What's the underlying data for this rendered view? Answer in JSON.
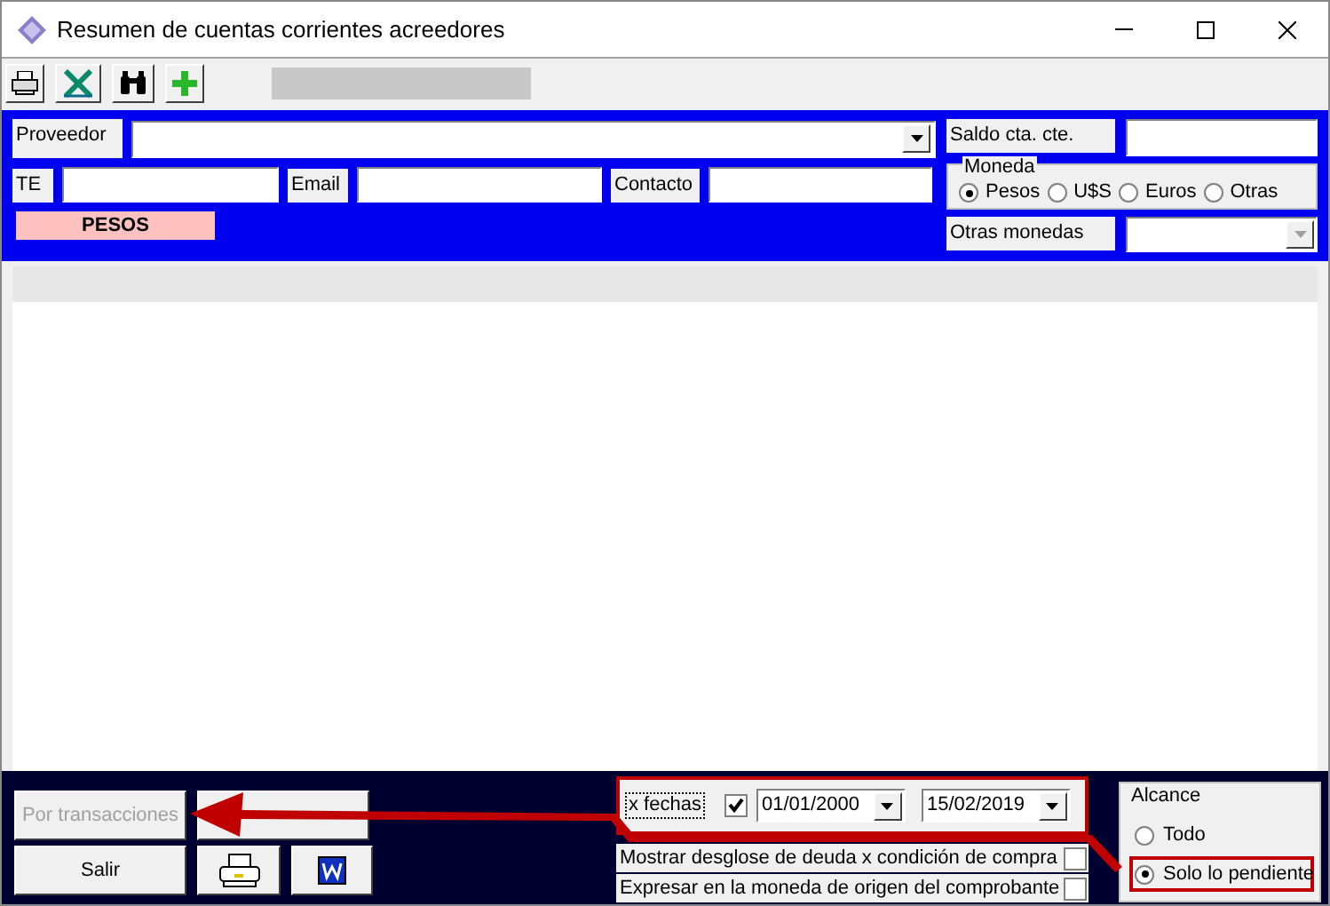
{
  "window": {
    "title": "Resumen de cuentas corrientes acreedores"
  },
  "form": {
    "proveedor_label": "Proveedor",
    "te_label": "TE",
    "email_label": "Email",
    "contacto_label": "Contacto",
    "currency_badge": "PESOS",
    "saldo_label": "Saldo cta. cte.",
    "otras_monedas_label": "Otras monedas",
    "moneda": {
      "title": "Moneda",
      "options": [
        {
          "label": "Pesos",
          "selected": true
        },
        {
          "label": "U$S",
          "selected": false
        },
        {
          "label": "Euros",
          "selected": false
        },
        {
          "label": "Otras",
          "selected": false
        }
      ]
    }
  },
  "footer": {
    "buttons": [
      {
        "label": "Por transacciones",
        "disabled": true
      },
      {
        "label": "Salir",
        "disabled": false
      }
    ],
    "date_filter": {
      "label": "x fechas",
      "checked": true,
      "from": "01/01/2000",
      "to": "15/02/2019"
    },
    "options": [
      {
        "label": "Mostrar desglose de deuda x condición de compra",
        "checked": false
      },
      {
        "label": "Expresar en la moneda de origen del comprobante",
        "checked": false
      }
    ],
    "alcance": {
      "title": "Alcance",
      "options": [
        {
          "label": "Todo",
          "selected": false
        },
        {
          "label": "Solo lo pendiente",
          "selected": true
        }
      ]
    }
  }
}
